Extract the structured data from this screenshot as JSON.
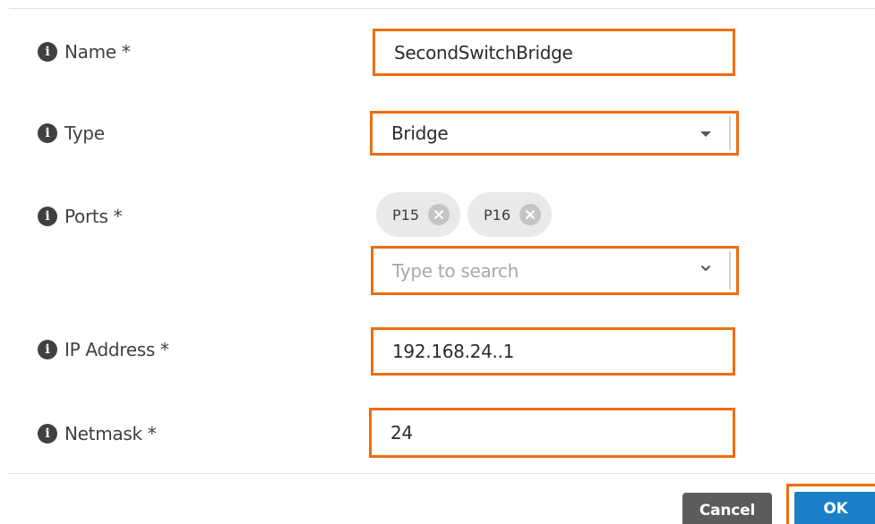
{
  "form": {
    "name": {
      "label": "Name *",
      "value": "SecondSwitchBridge"
    },
    "type": {
      "label": "Type",
      "value": "Bridge"
    },
    "ports": {
      "label": "Ports *",
      "chips": [
        "P15",
        "P16"
      ],
      "placeholder": "Type to search"
    },
    "ip_address": {
      "label": "IP Address *",
      "value": "192.168.24..1"
    },
    "netmask": {
      "label": "Netmask *",
      "value": "24"
    }
  },
  "info_icon_glyph": "i",
  "buttons": {
    "cancel": "Cancel",
    "ok": "OK"
  },
  "colors": {
    "highlight": "#ee6d10",
    "ok_button": "#1a7fc6",
    "cancel_button": "#5c5c5c",
    "info_icon": "#404040"
  },
  "icons": {
    "info": "info-icon",
    "dropdown": "caret-down-icon",
    "search_dropdown": "chevron-down-icon",
    "chip_remove": "close-circle-icon"
  }
}
